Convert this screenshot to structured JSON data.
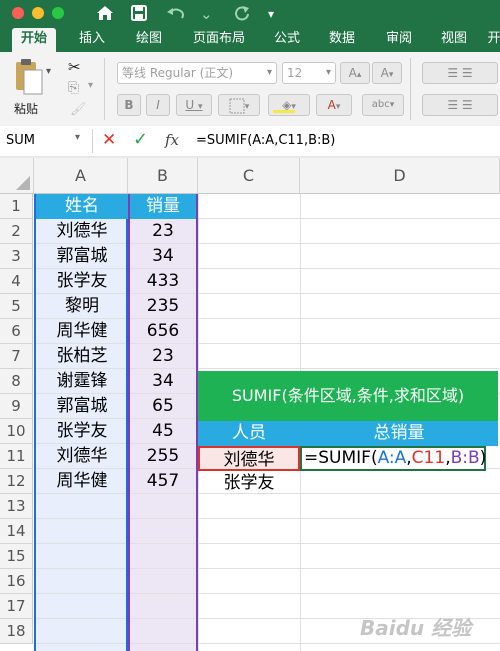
{
  "titlebar": {
    "traffic_colors": [
      "#ff5f57",
      "#febc2e",
      "#28c840"
    ],
    "icons": [
      "home-icon",
      "save-icon",
      "undo-icon",
      "redo-icon",
      "customize-icon"
    ]
  },
  "tabs": [
    "开始",
    "插入",
    "绘图",
    "页面布局",
    "公式",
    "数据",
    "审阅",
    "视图",
    "开"
  ],
  "ribbon": {
    "paste_label": "粘贴",
    "font_name": "等线 Regular (正文)",
    "font_size": "12",
    "bold": "B",
    "italic": "I",
    "underline": "U",
    "grow_font": "A",
    "shrink_font": "A"
  },
  "formula_bar": {
    "name_box": "SUM",
    "cancel": "✕",
    "enter": "✓",
    "fx": "fx",
    "formula": "=SUMIF(A:A,C11,B:B)"
  },
  "columns": [
    "A",
    "B",
    "C",
    "D"
  ],
  "rows": [
    "1",
    "2",
    "3",
    "4",
    "5",
    "6",
    "7",
    "8",
    "9",
    "10",
    "11",
    "12",
    "13",
    "14",
    "15",
    "16",
    "17",
    "18"
  ],
  "table": {
    "header_name": "姓名",
    "header_sales": "销量",
    "names": [
      "刘德华",
      "郭富城",
      "张学友",
      "黎明",
      "周华健",
      "张柏芝",
      "谢霆锋",
      "郭富城",
      "张学友",
      "刘德华",
      "周华健"
    ],
    "sales": [
      "23",
      "34",
      "433",
      "235",
      "656",
      "23",
      "34",
      "65",
      "45",
      "255",
      "457"
    ]
  },
  "note": {
    "banner": "SUMIF(条件区域,条件,求和区域)",
    "header_person": "人员",
    "header_total": "总销量",
    "person_1": "刘德华",
    "person_2": "张学友",
    "formula_parts": {
      "prefix": "=SUMIF(",
      "range1": "A:A",
      "comma1": ",",
      "criteria": "C11",
      "comma2": ",",
      "range2": "B:B",
      "suffix": ")"
    }
  },
  "watermark": "Baidu 经验",
  "colors": {
    "excel_green": "#217346",
    "header_blue": "#29abe2",
    "banner_green": "#1eb254",
    "range_blue": "#1f6fd8",
    "range_purple": "#7a3fb0",
    "criteria_red": "#d9342b"
  }
}
